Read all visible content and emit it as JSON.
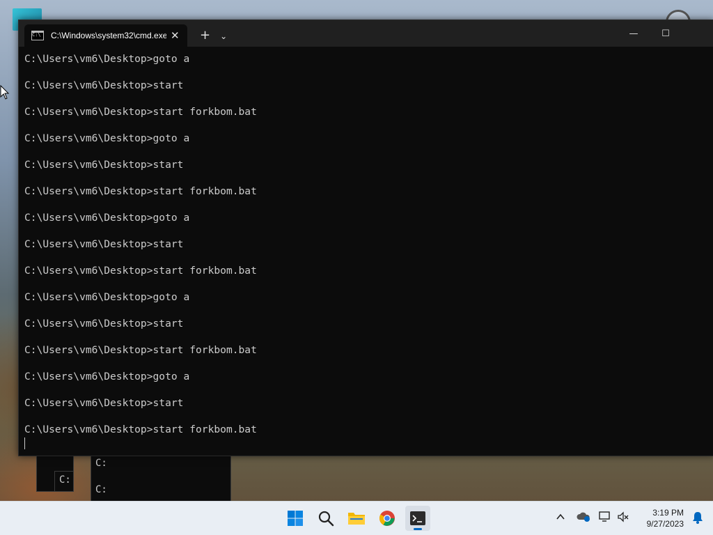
{
  "terminal": {
    "tab_title": "C:\\Windows\\system32\\cmd.exe",
    "tab_icon_text": "C:\\",
    "new_tab": "+",
    "dropdown": "⌄",
    "close": "✕",
    "minimize": "—",
    "maximize": "☐",
    "lines": [
      "C:\\Users\\vm6\\Desktop>goto a",
      "",
      "C:\\Users\\vm6\\Desktop>start",
      "",
      "C:\\Users\\vm6\\Desktop>start forkbom.bat",
      "",
      "C:\\Users\\vm6\\Desktop>goto a",
      "",
      "C:\\Users\\vm6\\Desktop>start",
      "",
      "C:\\Users\\vm6\\Desktop>start forkbom.bat",
      "",
      "C:\\Users\\vm6\\Desktop>goto a",
      "",
      "C:\\Users\\vm6\\Desktop>start",
      "",
      "C:\\Users\\vm6\\Desktop>start forkbom.bat",
      "",
      "C:\\Users\\vm6\\Desktop>goto a",
      "",
      "C:\\Users\\vm6\\Desktop>start",
      "",
      "C:\\Users\\vm6\\Desktop>start forkbom.bat",
      "",
      "C:\\Users\\vm6\\Desktop>goto a",
      "",
      "C:\\Users\\vm6\\Desktop>start",
      "",
      "C:\\Users\\vm6\\Desktop>start forkbom.bat"
    ]
  },
  "background_windows": {
    "bg1_text": "C:",
    "bg2_text": "C:",
    "bg3_line1": "C:",
    "bg3_line2": "C:"
  },
  "taskbar": {
    "apps": [
      "start-icon",
      "search-icon",
      "file-explorer-icon",
      "chrome-icon",
      "terminal-icon"
    ],
    "tray_icons": [
      "chevron-up-icon",
      "onedrive-icon",
      "network-icon",
      "volume-muted-icon",
      "notification-bell-icon"
    ],
    "time": "3:19 PM",
    "date": "9/27/2023"
  },
  "colors": {
    "console_bg": "#0c0c0c",
    "console_fg": "#cccccc",
    "titlebar": "#202020",
    "taskbar": "#e9eef4",
    "accent": "#0067c0"
  }
}
